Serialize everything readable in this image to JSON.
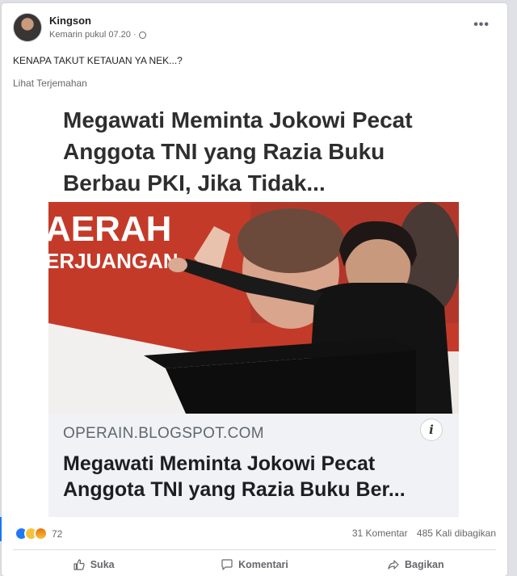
{
  "post": {
    "author": "Kingson",
    "timestamp": "Kemarin pukul 07.20 ·",
    "text": "KENAPA TAKUT KETAUAN YA NEK...?",
    "translate": "Lihat Terjemahan",
    "more": "•••"
  },
  "embed": {
    "headline": "Megawati Meminta Jokowi Pecat Anggota TNI yang Razia Buku Berbau PKI, Jika Tidak...",
    "photo_sign_1": "AERAH",
    "photo_sign_2": "ERJUANGAN",
    "domain": "OPERAIN.BLOGSPOT.COM",
    "info": "i",
    "link_title": "Megawati Meminta Jokowi Pecat Anggota TNI yang Razia Buku Ber..."
  },
  "stats": {
    "reaction_count": "72",
    "comments": "31 Komentar",
    "shares": "485 Kali dibagikan"
  },
  "actions": {
    "like": "Suka",
    "comment": "Komentari",
    "share": "Bagikan"
  },
  "colors": {
    "accent": "#1877f2",
    "photo_red": "#c43a29"
  }
}
